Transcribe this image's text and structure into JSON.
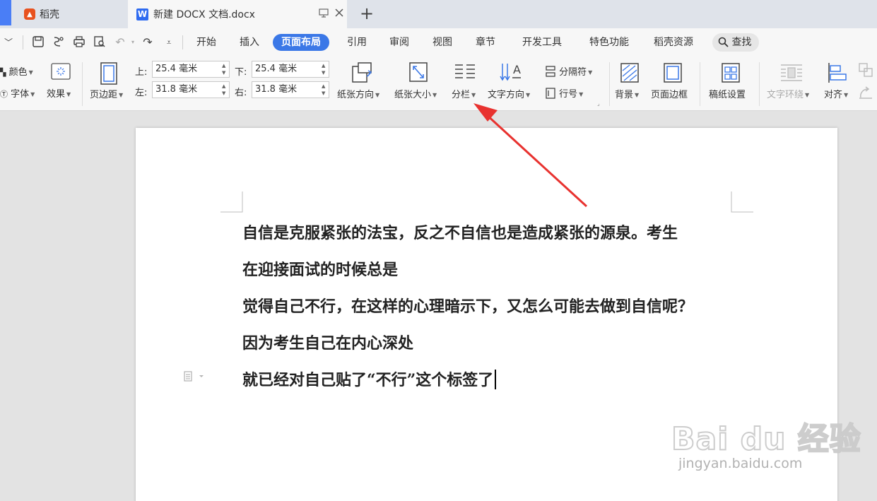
{
  "tabs": {
    "daoke_label": "稻壳",
    "doc_title": "新建 DOCX 文档.docx",
    "new_tab": "+"
  },
  "menu": {
    "items": [
      "开始",
      "插入",
      "页面布局",
      "引用",
      "审阅",
      "视图",
      "章节",
      "开发工具",
      "特色功能",
      "稻壳资源"
    ],
    "active": "页面布局",
    "search_label": "查找"
  },
  "ribbon": {
    "color_label": "颜色",
    "font_label": "字体",
    "effects_label": "效果",
    "margins_label": "页边距",
    "top_label": "上:",
    "top_value": "25.4 毫米",
    "bottom_label": "下:",
    "bottom_value": "25.4 毫米",
    "left_label": "左:",
    "left_value": "31.8 毫米",
    "right_label": "右:",
    "right_value": "31.8 毫米",
    "orientation_label": "纸张方向",
    "size_label": "纸张大小",
    "columns_label": "分栏",
    "text_direction_label": "文字方向",
    "breaks_label": "分隔符",
    "line_numbers_label": "行号",
    "background_label": "背景",
    "page_border_label": "页面边框",
    "manuscript_label": "稿纸设置",
    "text_wrap_label": "文字环绕",
    "align_label": "对齐"
  },
  "document": {
    "lines": [
      "自信是克服紧张的法宝，反之不自信也是造成紧张的源泉。考生",
      "在迎接面试的时候总是",
      "觉得自己不行，在这样的心理暗示下，又怎么可能去做到自信呢？",
      "因为考生自己在内心深处",
      "就已经对自己贴了“不行”这个标签了"
    ]
  },
  "watermark": {
    "brand": "Bai du 经验",
    "url": "jingyan.baidu.com"
  },
  "colors": {
    "accent": "#3b78e7",
    "arrow": "#e8322f",
    "tab_edge": "#4a7ef6"
  }
}
